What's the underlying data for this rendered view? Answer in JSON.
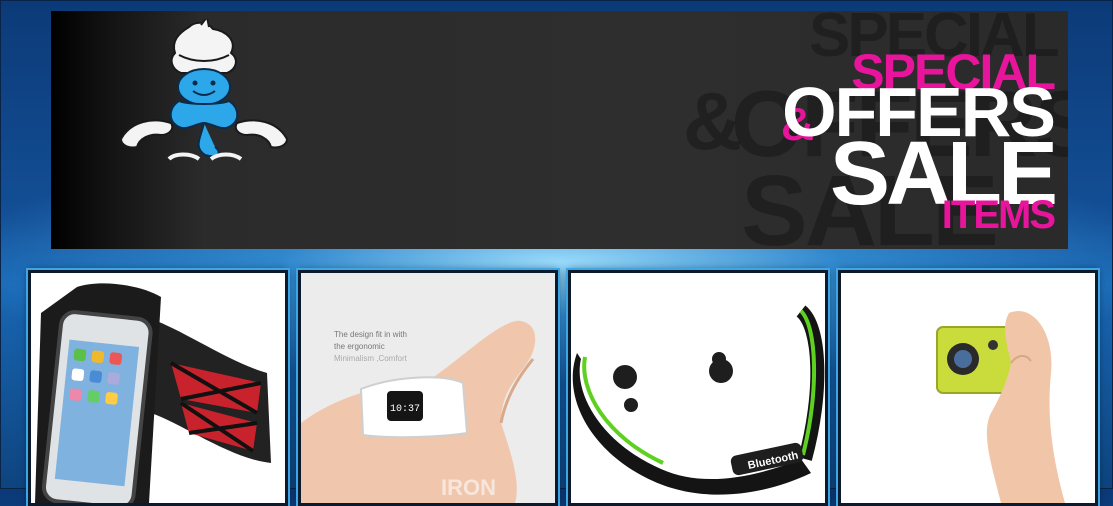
{
  "banner": {
    "headline_special": "SPECIAL",
    "headline_amp": "&",
    "headline_offers": "OFFERS",
    "headline_sale": "SALE",
    "headline_items": "ITEMS",
    "accent_color": "#e8149c",
    "logo_icon": "genie-mascot-icon"
  },
  "products": [
    {
      "icon": "phone-armband-icon"
    },
    {
      "icon": "fitness-band-icon",
      "caption_line1": "The design fit in with",
      "caption_line2": "the ergonomic",
      "caption_line3": "Minimalism ,Comfort",
      "watch_time": "10:37",
      "band_mark": "IRON"
    },
    {
      "icon": "bluetooth-headphones-icon",
      "brand_label": "Bluetooth"
    },
    {
      "icon": "action-camera-icon"
    }
  ]
}
